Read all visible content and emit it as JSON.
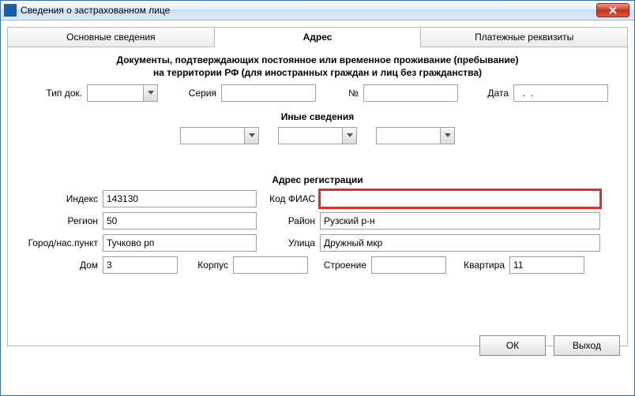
{
  "window": {
    "title": "Сведения о застрахованном лице"
  },
  "tabs": {
    "general": "Основные сведения",
    "address": "Адрес",
    "payment": "Платежные реквизиты"
  },
  "doc": {
    "heading": "Документы, подтверждающих постоянное или временное проживание (пребывание)",
    "subheading": "на территории РФ (для иностранных граждан и лиц без гражданства)",
    "type_label": "Тип док.",
    "type_value": "",
    "series_label": "Серия",
    "series_value": "",
    "number_label": "№",
    "number_value": "",
    "date_label": "Дата",
    "date_value": "  .  .    "
  },
  "other": {
    "title": "Иные сведения",
    "sel1": "",
    "sel2": "",
    "sel3": ""
  },
  "reg": {
    "title": "Адрес регистрации",
    "index_label": "Индекс",
    "index_value": "143130",
    "fias_label": "Код ФИАС",
    "fias_value": "",
    "region_label": "Регион",
    "region_value": "50",
    "district_label": "Район",
    "district_value": "Рузский р-н",
    "city_label": "Город/нас.пункт",
    "city_value": "Тучково рп",
    "street_label": "Улица",
    "street_value": "Дружный мкр",
    "house_label": "Дом",
    "house_value": "3",
    "korpus_label": "Корпус",
    "korpus_value": "",
    "building_label": "Строение",
    "building_value": "",
    "flat_label": "Квартира",
    "flat_value": "11"
  },
  "buttons": {
    "ok": "ОК",
    "exit": "Выход"
  }
}
